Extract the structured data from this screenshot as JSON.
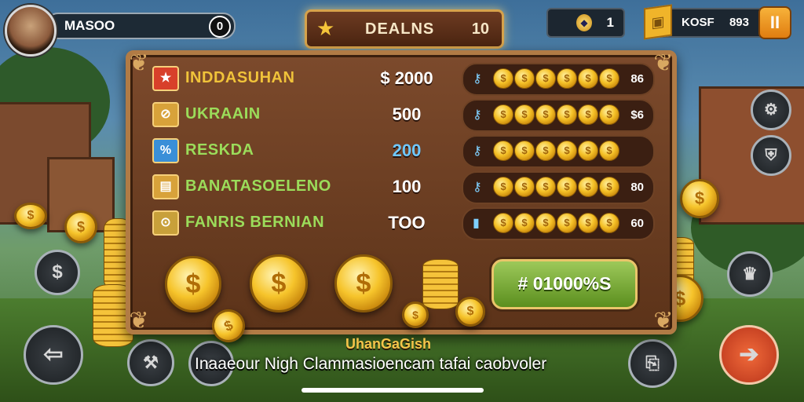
{
  "player": {
    "name": "MASOO",
    "level": "0",
    "avatar_icon": "player-portrait"
  },
  "header": {
    "star_icon": "star-icon",
    "title": "DEALNS",
    "count": "10"
  },
  "currency": {
    "gems_value": "1",
    "resource_label": "KOSF",
    "resource_value": "893"
  },
  "pause_icon": "pause-icon",
  "rows": [
    {
      "icon": "★",
      "label": "INDDASUHAN",
      "amount": "$ 2000",
      "track_icon": "key-icon",
      "reward": "86",
      "label_color": "#f0c33a",
      "icon_bg": "#d8402a"
    },
    {
      "icon": "⊘",
      "label": "UKRAAIN",
      "amount": "500",
      "track_icon": "key-icon",
      "reward": "$6",
      "label_color": "#9bdc5a",
      "icon_bg": "#d8a23a"
    },
    {
      "icon": "%",
      "label": "RESKDA",
      "amount": "200",
      "track_icon": "key-icon",
      "reward": "",
      "label_color": "#9bdc5a",
      "icon_bg": "#3a8fd8"
    },
    {
      "icon": "▤",
      "label": "BANATASOELENO",
      "amount": "100",
      "track_icon": "key-icon",
      "reward": "80",
      "label_color": "#9bdc5a",
      "icon_bg": "#d8a23a"
    },
    {
      "icon": "⊙",
      "label": "FANRIS BERNIAN",
      "amount": "TOO",
      "track_icon": "card-icon",
      "reward": "60",
      "label_color": "#9bdc5a",
      "icon_bg": "#c8a03a"
    }
  ],
  "collect_button": "# 01000%S",
  "subtitle": "UhanGaGish",
  "caption": "Inaaeour Nigh Clammasioencam tafai caobvoler",
  "colors": {
    "panel": "#6b3d22",
    "accent": "#f5c127",
    "button": "#7fb23a"
  }
}
